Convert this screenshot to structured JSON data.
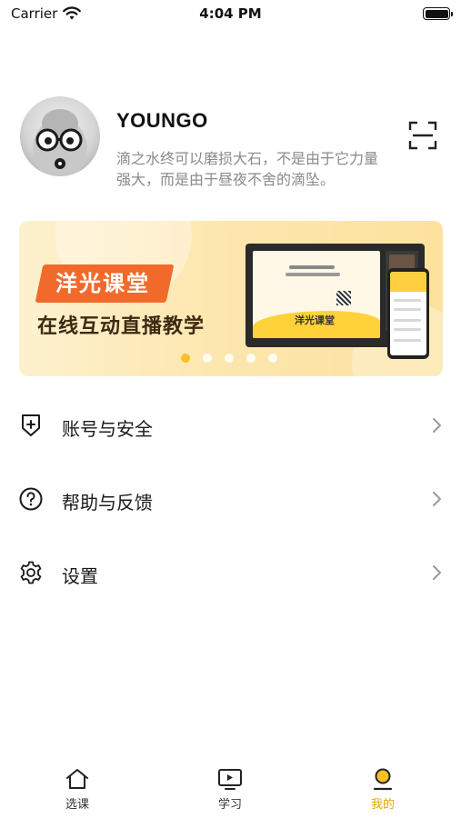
{
  "status_bar": {
    "carrier": "Carrier",
    "time": "4:04 PM"
  },
  "profile": {
    "username": "YOUNGO",
    "motto": "滴之水终可以磨损大石，不是由于它力量强大，而是由于昼夜不舍的滴坠。",
    "avatar_icon": "egg-mascot-avatar",
    "scan_icon": "scan-icon"
  },
  "banner": {
    "brand": "洋光课堂",
    "slogan": "在线互动直播教学",
    "laptop_logo": "洋光课堂",
    "slide_count": 5,
    "active_slide": 1,
    "colors": {
      "tag": "#f26a2b",
      "dot_active": "#f9c023",
      "background": "#fde7b0"
    }
  },
  "menu": {
    "items": [
      {
        "label": "账号与安全",
        "icon": "shield-plus-icon"
      },
      {
        "label": "帮助与反馈",
        "icon": "help-circle-icon"
      },
      {
        "label": "设置",
        "icon": "gear-icon"
      }
    ]
  },
  "tabbar": {
    "tabs": [
      {
        "label": "选课",
        "icon": "home-icon",
        "active": false
      },
      {
        "label": "学习",
        "icon": "play-screen-icon",
        "active": false
      },
      {
        "label": "我的",
        "icon": "user-icon",
        "active": true
      }
    ],
    "active_color": "#e6a400"
  }
}
